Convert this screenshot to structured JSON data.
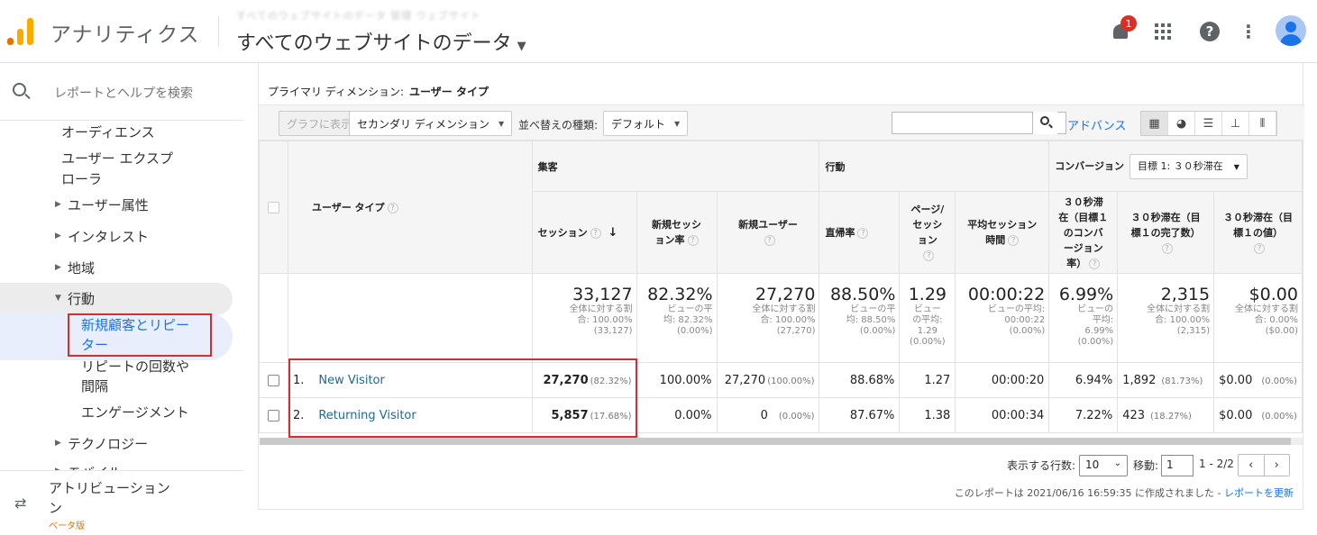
{
  "app": {
    "title": "アナリティクス",
    "account": "すべてのウェブサイトのデータ 管理 ウェブサイト",
    "property": "すべてのウェブサイトのデータ",
    "notifications": "1",
    "logo_colors": [
      "#f9ab00",
      "#e37400"
    ]
  },
  "sidebar": {
    "search_placeholder": "レポートとヘルプを検索",
    "items": [
      {
        "label": "オーディエンス"
      },
      {
        "label": "ユーザー エクスプ"
      },
      {
        "label": "ローラ"
      },
      {
        "label": "ユーザー属性"
      },
      {
        "label": "インタレスト"
      },
      {
        "label": "地域"
      },
      {
        "label": "行動"
      },
      {
        "label": "新規顧客とリピー"
      },
      {
        "label": "ター"
      },
      {
        "label": "リピートの回数や"
      },
      {
        "label": "間隔"
      },
      {
        "label": "エンゲージメント"
      },
      {
        "label": "テクノロジー"
      },
      {
        "label": "モバイル"
      }
    ],
    "attribution": "アトリビューション",
    "attribution_line2": "ン",
    "beta": "ベータ版"
  },
  "report": {
    "primary_dimension_label": "プライマリ ディメンション:",
    "primary_dimension_value": "ユーザー タイプ",
    "chart_button": "グラフに表示",
    "secondary_dimension": "セカンダリ ディメンション",
    "sort_label": "並べ替えの種類:",
    "sort_value": "デフォルト",
    "advanced": "アドバンス"
  },
  "table": {
    "dim_header": "ユーザー タイプ",
    "group_acquisition": "集客",
    "group_behavior": "行動",
    "group_conversion": "コンバージョン",
    "goal_select": "目標 1: ３０秒滞在",
    "col_sessions": "セッション",
    "col_new_sessions_1": "新規セッシ",
    "col_new_sessions_2": "ョン率",
    "col_new_users": "新規ユーザー",
    "col_bounce": "直帰率",
    "col_pps_1": "ページ/",
    "col_pps_2": "セッシ",
    "col_pps_3": "ョン",
    "col_avg_1": "平均セッション",
    "col_avg_2": "時間",
    "col_cr_1": "３０秒滞",
    "col_cr_2": "在（目標１",
    "col_cr_3": "のコンバ",
    "col_cr_4": "ージョン",
    "col_cr_5": "率）",
    "col_comp_1": "３０秒滞在（目",
    "col_comp_2": "標１の完了数）",
    "col_val_1": "３０秒滞在（目",
    "col_val_2": "標１の値）",
    "totals": {
      "sessions": "33,127",
      "sessions_sub1": "全体に対する割",
      "sessions_sub2": "合: 100.00%",
      "sessions_sub3": "(33,127)",
      "new_sessions": "82.32%",
      "new_sessions_sub1": "ビューの平",
      "new_sessions_sub2": "均: 82.32%",
      "new_sessions_sub3": "(0.00%)",
      "new_users": "27,270",
      "new_users_sub1": "全体に対する割",
      "new_users_sub2": "合: 100.00%",
      "new_users_sub3": "(27,270)",
      "bounce": "88.50%",
      "bounce_sub1": "ビューの平",
      "bounce_sub2": "均: 88.50%",
      "bounce_sub3": "(0.00%)",
      "pps": "1.29",
      "pps_sub1": "ビュー",
      "pps_sub2": "の平均:",
      "pps_sub3": "1.29",
      "pps_sub4": "(0.00%)",
      "avg": "00:00:22",
      "avg_sub1": "ビューの平均:",
      "avg_sub2": "00:00:22",
      "avg_sub3": "(0.00%)",
      "cr": "6.99%",
      "cr_sub1": "ビューの",
      "cr_sub2": "平均:",
      "cr_sub3": "6.99%",
      "cr_sub4": "(0.00%)",
      "comp": "2,315",
      "comp_sub1": "全体に対する割",
      "comp_sub2": "合: 100.00%",
      "comp_sub3": "(2,315)",
      "val": "$0.00",
      "val_sub1": "全体に対する割",
      "val_sub2": "合: 0.00%",
      "val_sub3": "($0.00)"
    },
    "rows": [
      {
        "num": "1.",
        "type": "New Visitor",
        "sessions": "27,270",
        "sessions_pct": "(82.32%)",
        "new_sessions": "100.00%",
        "new_users": "27,270",
        "new_users_pct": "(100.00%)",
        "bounce": "88.68%",
        "pps": "1.27",
        "avg": "00:00:20",
        "cr": "6.94%",
        "comp": "1,892",
        "comp_pct": "(81.73%)",
        "val": "$0.00",
        "val_pct": "(0.00%)"
      },
      {
        "num": "2.",
        "type": "Returning Visitor",
        "sessions": "5,857",
        "sessions_pct": "(17.68%)",
        "new_sessions": "0.00%",
        "new_users": "0",
        "new_users_pct": "(0.00%)",
        "bounce": "87.67%",
        "pps": "1.38",
        "avg": "00:00:34",
        "cr": "7.22%",
        "comp": "423",
        "comp_pct": "(18.27%)",
        "val": "$0.00",
        "val_pct": "(0.00%)"
      }
    ]
  },
  "pager": {
    "rows_label": "表示する行数:",
    "rows_value": "10",
    "goto_label": "移動:",
    "goto_value": "1",
    "range": "1 - 2/2",
    "prev": "‹",
    "next": "›"
  },
  "footer": {
    "created": "このレポートは 2021/06/16 16:59:35 に作成されました -",
    "refresh": "レポートを更新"
  }
}
